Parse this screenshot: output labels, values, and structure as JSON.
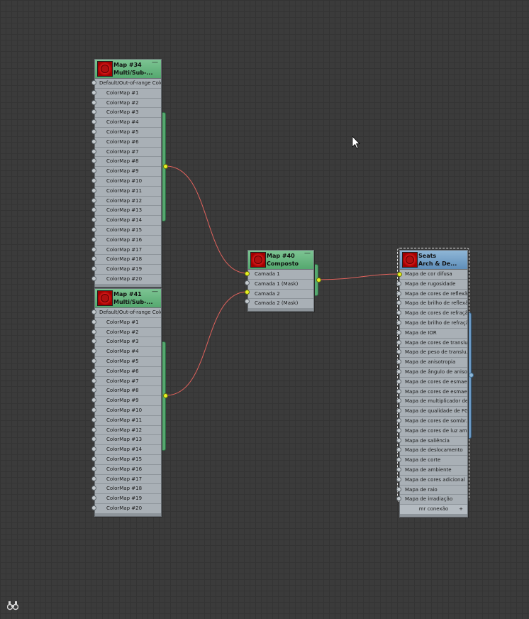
{
  "nodes": {
    "map34": {
      "title1": "Map #34",
      "title2": "Multi/Sub-...",
      "minimize": "—",
      "slots": [
        "Default/Out-of-range Color",
        "ColorMap #1",
        "ColorMap #2",
        "ColorMap #3",
        "ColorMap #4",
        "ColorMap #5",
        "ColorMap #6",
        "ColorMap #7",
        "ColorMap #8",
        "ColorMap #9",
        "ColorMap #10",
        "ColorMap #11",
        "ColorMap #12",
        "ColorMap #13",
        "ColorMap #14",
        "ColorMap #15",
        "ColorMap #16",
        "ColorMap #17",
        "ColorMap #18",
        "ColorMap #19",
        "ColorMap #20"
      ]
    },
    "map41": {
      "title1": "Map #41",
      "title2": "Multi/Sub-...",
      "minimize": "—",
      "slots": [
        "Default/Out-of-range Color",
        "ColorMap #1",
        "ColorMap #2",
        "ColorMap #3",
        "ColorMap #4",
        "ColorMap #5",
        "ColorMap #6",
        "ColorMap #7",
        "ColorMap #8",
        "ColorMap #9",
        "ColorMap #10",
        "ColorMap #11",
        "ColorMap #12",
        "ColorMap #13",
        "ColorMap #14",
        "ColorMap #15",
        "ColorMap #16",
        "ColorMap #17",
        "ColorMap #18",
        "ColorMap #19",
        "ColorMap #20"
      ]
    },
    "map40": {
      "title1": "Map #40",
      "title2": "Composto",
      "minimize": "—",
      "slots": [
        "Camada 1",
        "Camada 1 (Mask)",
        "Camada 2",
        "Camada 2 (Mask)"
      ]
    },
    "seats": {
      "title1": "Seats",
      "title2": "Arch & De...",
      "slots": [
        "Mapa de cor difusa",
        "Mapa de rugosidade",
        "Mapa de cores de reflexão",
        "Mapa de brilho de reflexão",
        "Mapa de cores de refração",
        "Mapa de brilho de refração",
        "Mapa de IOR",
        "Mapa de cores de translu...",
        "Mapa de peso de translu...",
        "Mapa de anisotropia",
        "Mapa de ângulo de aniso...",
        "Mapa de cores de esmae...",
        "Mapa de cores de esmae...",
        "Mapa de multiplicador de...",
        "Mapa de qualidade de FG",
        "Mapa de cores de sombr...",
        "Mapa de cores de luz am...",
        "Mapa de saliência",
        "Mapa de deslocamento",
        "Mapa de corte",
        "Mapa de ambiente",
        "Mapa de cores adicional",
        "Mapa de raio",
        "Mapa de irradiação"
      ],
      "group": "mr conexão",
      "group_toggle": "+"
    }
  },
  "colors": {
    "wire": "#e0625c",
    "port_active": "#e5f020",
    "material_header": "#6b98c2",
    "map_header": "#55a86f"
  }
}
